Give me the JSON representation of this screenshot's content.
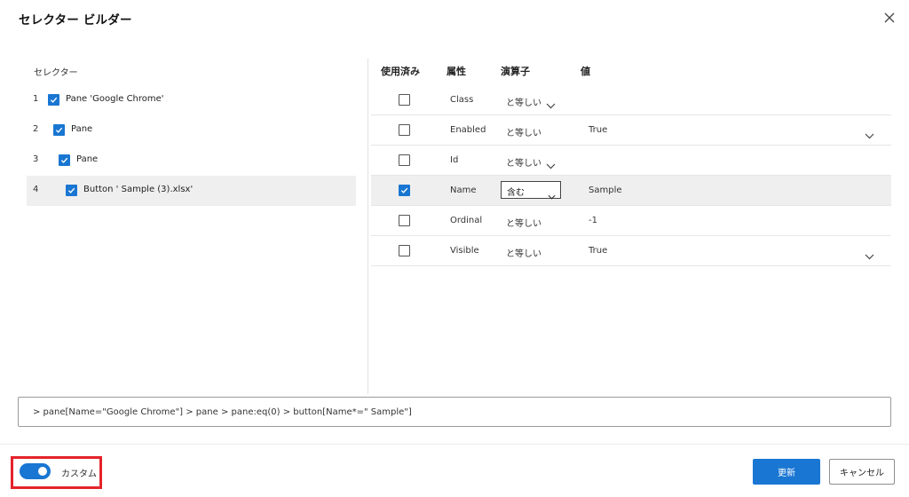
{
  "dialog": {
    "title": "セレクター ビルダー",
    "close_icon": "close-icon"
  },
  "left_panel": {
    "label": "セレクター",
    "items": [
      {
        "num": "1",
        "text": "Pane 'Google Chrome'",
        "checked": true,
        "selected": false
      },
      {
        "num": "2",
        "text": "Pane",
        "checked": true,
        "selected": false
      },
      {
        "num": "3",
        "text": "Pane",
        "checked": true,
        "selected": false
      },
      {
        "num": "4",
        "text": "Button ' Sample (3).xlsx'",
        "checked": true,
        "selected": true
      }
    ]
  },
  "right_panel": {
    "headers": {
      "used": "使用済み",
      "attribute": "属性",
      "operator": "演算子",
      "value": "値"
    },
    "rows": [
      {
        "attribute": "Class",
        "used": false,
        "operator": "と等しい",
        "operator_dropdown": true,
        "value": "",
        "value_dropdown": false,
        "selected": false,
        "editing": false
      },
      {
        "attribute": "Enabled",
        "used": false,
        "operator": "と等しい",
        "operator_dropdown": false,
        "value": "True",
        "value_dropdown": true,
        "selected": false,
        "editing": false
      },
      {
        "attribute": "Id",
        "used": false,
        "operator": "と等しい",
        "operator_dropdown": true,
        "value": "",
        "value_dropdown": false,
        "selected": false,
        "editing": false
      },
      {
        "attribute": "Name",
        "used": true,
        "operator": "含む",
        "operator_dropdown": true,
        "value": "Sample",
        "value_dropdown": false,
        "selected": true,
        "editing": true
      },
      {
        "attribute": "Ordinal",
        "used": false,
        "operator": "と等しい",
        "operator_dropdown": false,
        "value": "-1",
        "value_dropdown": false,
        "selected": false,
        "editing": false
      },
      {
        "attribute": "Visible",
        "used": false,
        "operator": "と等しい",
        "operator_dropdown": false,
        "value": "True",
        "value_dropdown": true,
        "selected": false,
        "editing": false
      }
    ]
  },
  "selector_expression": "> pane[Name=\"Google Chrome\"] > pane > pane:eq(0) > button[Name*=\" Sample\"]",
  "footer": {
    "custom_toggle_on": true,
    "custom_label": "カスタム",
    "update_button": "更新",
    "cancel_button": "キャンセル"
  },
  "colors": {
    "accent": "#1976d2",
    "highlight": "#e4232a",
    "selected_row": "#efefef"
  }
}
